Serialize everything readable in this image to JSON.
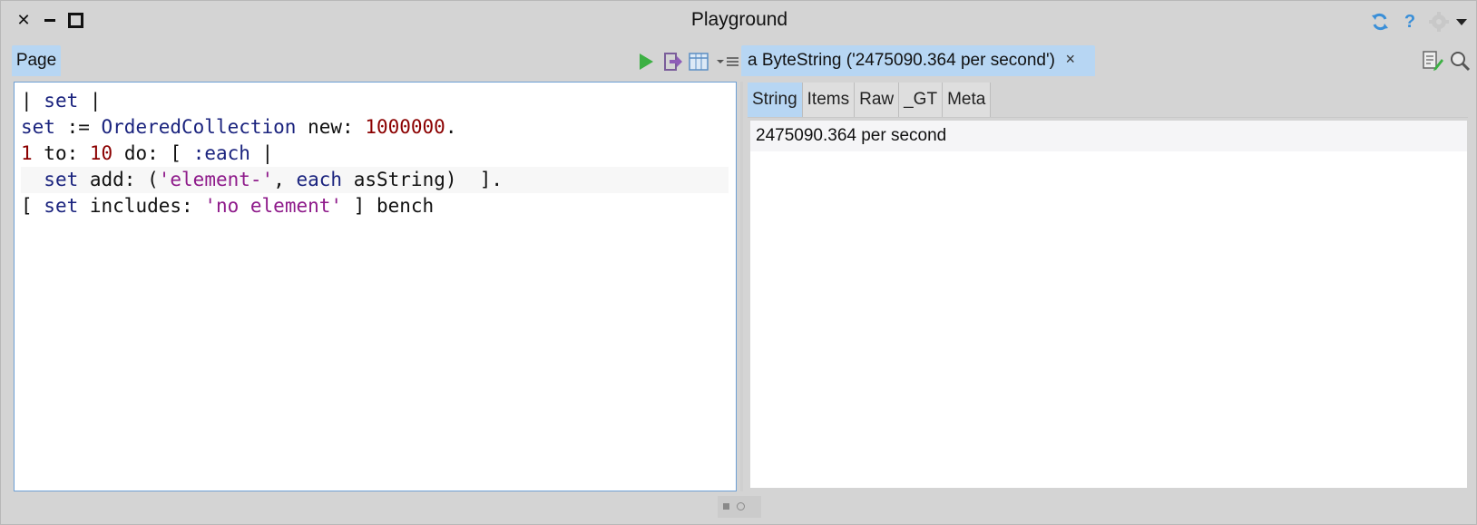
{
  "window": {
    "title": "Playground",
    "help_label": "?"
  },
  "left_pane": {
    "tab_label": "Page",
    "code_lines": [
      [
        {
          "t": "| ",
          "c": ""
        },
        {
          "t": "set",
          "c": "k"
        },
        {
          "t": " |",
          "c": ""
        }
      ],
      [
        {
          "t": "set",
          "c": "k"
        },
        {
          "t": " := ",
          "c": ""
        },
        {
          "t": "OrderedCollection",
          "c": "k"
        },
        {
          "t": " new: ",
          "c": ""
        },
        {
          "t": "1000000",
          "c": "n"
        },
        {
          "t": ".",
          "c": ""
        }
      ],
      [
        {
          "t": "1",
          "c": "n"
        },
        {
          "t": " to: ",
          "c": ""
        },
        {
          "t": "10",
          "c": "n"
        },
        {
          "t": " do: [ ",
          "c": ""
        },
        {
          "t": ":each",
          "c": "k"
        },
        {
          "t": " |",
          "c": ""
        }
      ],
      [
        {
          "t": "  ",
          "c": ""
        },
        {
          "t": "set",
          "c": "k"
        },
        {
          "t": " add: (",
          "c": ""
        },
        {
          "t": "'element-'",
          "c": "s"
        },
        {
          "t": ", ",
          "c": ""
        },
        {
          "t": "each",
          "c": "k"
        },
        {
          "t": " asString)  ].",
          "c": ""
        }
      ],
      [
        {
          "t": "[ ",
          "c": ""
        },
        {
          "t": "set",
          "c": "k"
        },
        {
          "t": " includes: ",
          "c": ""
        },
        {
          "t": "'no element'",
          "c": "s"
        },
        {
          "t": " ] bench",
          "c": ""
        }
      ]
    ]
  },
  "inspector": {
    "tab_label": "a ByteString ('2475090.364 per second')",
    "close_label": "×",
    "view_tabs": [
      "String",
      "Items",
      "Raw",
      "_GT",
      "Meta"
    ],
    "active_view": "String",
    "value_text": "2475090.364 per second"
  },
  "colors": {
    "accent": "#b7d6f3",
    "code_keyword": "#1a237e",
    "code_number": "#8b0000",
    "code_string": "#8e1a8a",
    "play_green": "#3cb043",
    "sync_blue": "#3a8fd8"
  },
  "icons": [
    "close-icon",
    "minimize-icon",
    "maximize-icon",
    "sync-icon",
    "help-icon",
    "gear-icon",
    "menu-arrow-icon",
    "play-icon",
    "exit-icon",
    "table-icon",
    "list-menu-icon",
    "code-edit-icon",
    "search-icon"
  ]
}
